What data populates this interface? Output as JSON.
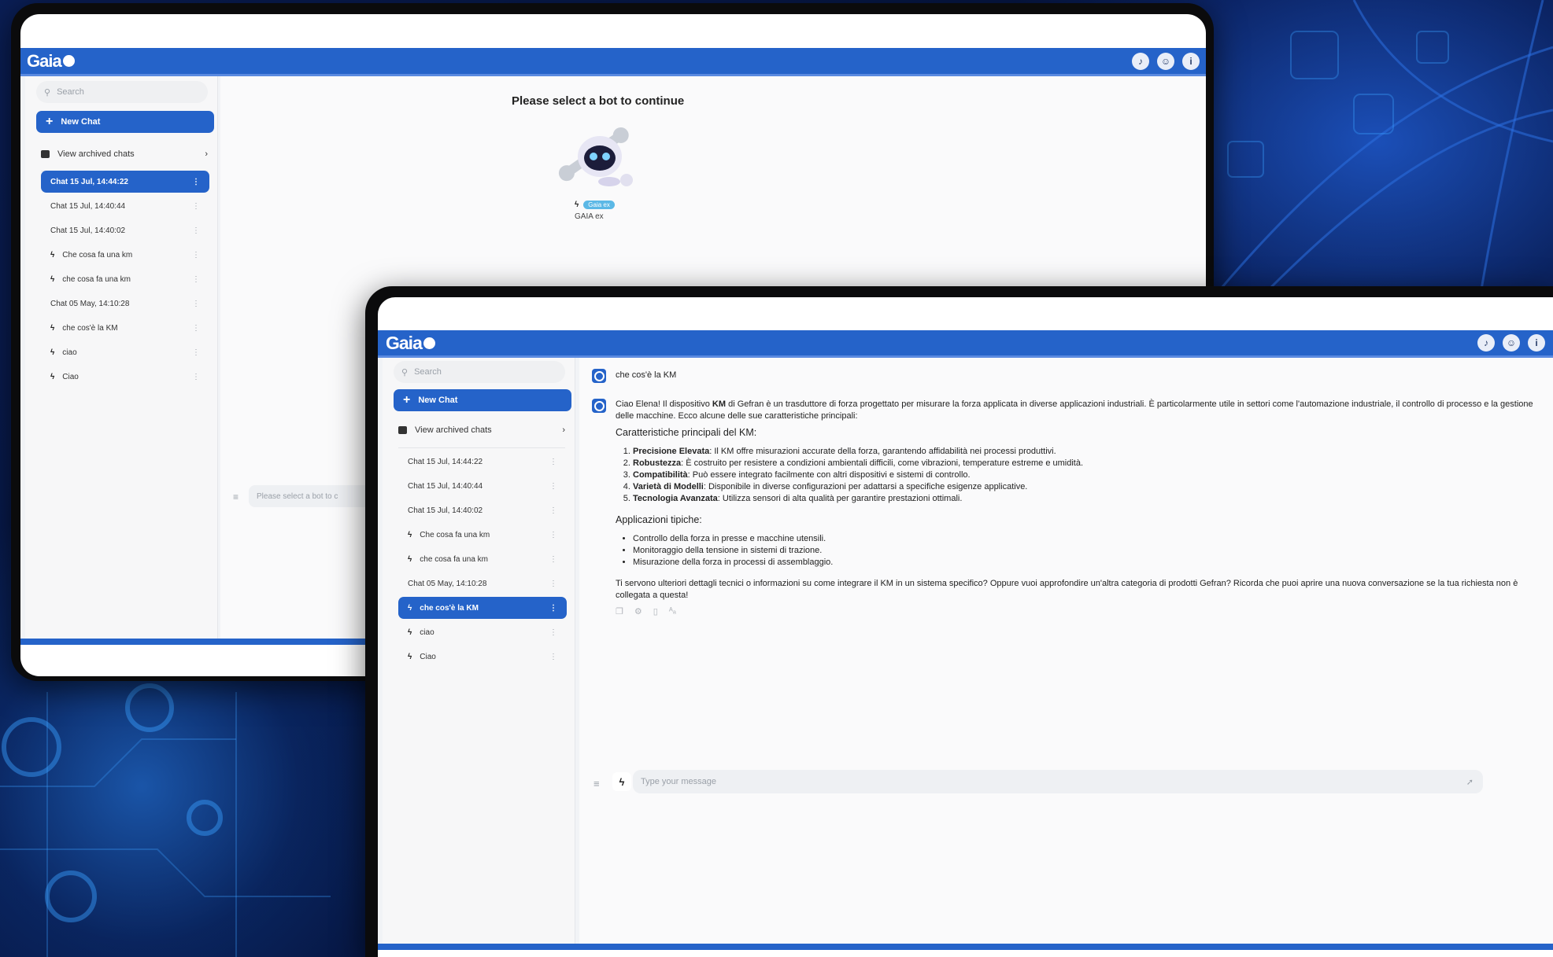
{
  "brand": {
    "logo": "Gaia",
    "accent": "#2563c9",
    "background": "#06163f"
  },
  "top_icons": [
    "bell-icon",
    "account-icon",
    "info-icon"
  ],
  "back_window": {
    "search_placeholder": "Search",
    "new_chat_label": "New Chat",
    "archived_label": "View archived chats",
    "chats": [
      {
        "label": "Chat 15 Jul, 14:44:22",
        "bolt": false,
        "active": true
      },
      {
        "label": "Chat 15 Jul, 14:40:44",
        "bolt": false,
        "active": false
      },
      {
        "label": "Chat 15 Jul, 14:40:02",
        "bolt": false,
        "active": false
      },
      {
        "label": "Che cosa fa una km",
        "bolt": true,
        "active": false
      },
      {
        "label": "che cosa fa una km",
        "bolt": true,
        "active": false
      },
      {
        "label": "Chat 05 May, 14:10:28",
        "bolt": false,
        "active": false
      },
      {
        "label": "che cos'è la KM",
        "bolt": true,
        "active": false
      },
      {
        "label": "ciao",
        "bolt": true,
        "active": false
      },
      {
        "label": "Ciao",
        "bolt": true,
        "active": false
      }
    ],
    "select_title": "Please select a bot to continue",
    "bot_badge": "Gaia ex",
    "bot_name": "GAIA ex",
    "input_placeholder": "Please select a bot to c"
  },
  "front_window": {
    "search_placeholder": "Search",
    "new_chat_label": "New Chat",
    "archived_label": "View archived chats",
    "chats": [
      {
        "label": "Chat 15 Jul, 14:44:22",
        "bolt": false,
        "active": false
      },
      {
        "label": "Chat 15 Jul, 14:40:44",
        "bolt": false,
        "active": false
      },
      {
        "label": "Chat 15 Jul, 14:40:02",
        "bolt": false,
        "active": false
      },
      {
        "label": "Che cosa fa una km",
        "bolt": true,
        "active": false
      },
      {
        "label": "che cosa fa una km",
        "bolt": true,
        "active": false
      },
      {
        "label": "Chat 05 May, 14:10:28",
        "bolt": false,
        "active": false
      },
      {
        "label": "che cos'è la KM",
        "bolt": true,
        "active": true
      },
      {
        "label": "ciao",
        "bolt": true,
        "active": false
      },
      {
        "label": "Ciao",
        "bolt": true,
        "active": false
      }
    ],
    "user_message": "che cos'è la KM",
    "answer": {
      "intro_parts": [
        "Ciao Elena! Il dispositivo ",
        "KM",
        " di Gefran è un trasduttore di forza progettato per misurare la forza applicata in diverse applicazioni industriali. È particolarmente utile in settori come l'automazione industriale, il controllo di processo e la gestione delle macchine. Ecco alcune delle sue caratteristiche principali:"
      ],
      "features_title": "Caratteristiche principali del KM:",
      "features": [
        {
          "term": "Precisione Elevata",
          "text": ": Il KM offre misurazioni accurate della forza, garantendo affidabilità nei processi produttivi."
        },
        {
          "term": "Robustezza",
          "text": ": È costruito per resistere a condizioni ambientali difficili, come vibrazioni, temperature estreme e umidità."
        },
        {
          "term": "Compatibilità",
          "text": ": Può essere integrato facilmente con altri dispositivi e sistemi di controllo."
        },
        {
          "term": "Varietà di Modelli",
          "text": ": Disponibile in diverse configurazioni per adattarsi a specifiche esigenze applicative."
        },
        {
          "term": "Tecnologia Avanzata",
          "text": ": Utilizza sensori di alta qualità per garantire prestazioni ottimali."
        }
      ],
      "applications_title": "Applicazioni tipiche:",
      "applications": [
        "Controllo della forza in presse e macchine utensili.",
        "Monitoraggio della tensione in sistemi di trazione.",
        "Misurazione della forza in processi di assemblaggio."
      ],
      "closing": "Ti servono ulteriori dettagli tecnici o informazioni su come integrare il KM in un sistema specifico? Oppure vuoi approfondire un'altra categoria di prodotti Gefran? Ricorda che puoi aprire una nuova conversazione se la tua richiesta non è collegata a questa!"
    },
    "input_placeholder": "Type your message"
  }
}
